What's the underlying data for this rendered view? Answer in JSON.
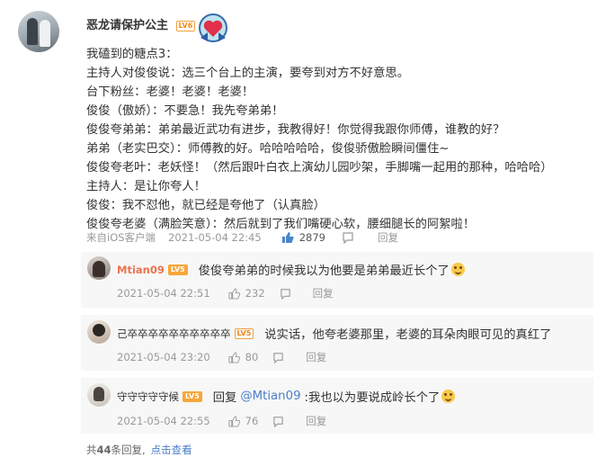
{
  "post": {
    "username": "恶龙请保护公主",
    "level": "LV6",
    "lines": [
      "我磕到的糖点3：",
      "主持人对俊俊说：选三个台上的主演，要夸到对方不好意思。",
      "台下粉丝：老婆！老婆！老婆！",
      "俊俊（傲娇）：不要急！我先夸弟弟！",
      "俊俊夸弟弟：弟弟最近武功有进步，我教得好！你觉得我跟你师傅，谁教的好？",
      "弟弟（老实巴交）：师傅教的好。哈哈哈哈哈，俊俊骄傲脸瞬间僵住~",
      "俊俊夸老叶：老妖怪！（然后跟叶白衣上演幼儿园吵架，手脚嘴一起用的那种，哈哈哈）",
      "主持人：是让你夸人！",
      "俊俊：我不怼他，就已经是夸他了（认真脸）",
      "俊俊夸老婆（满脸笑意）：然后就到了我们嘴硬心软，腰细腿长的阿絮啦！"
    ],
    "source": "来自iOS客户端",
    "time": "2021-05-04 22:45",
    "likes": "2879",
    "reply_label": "回复"
  },
  "replies": [
    {
      "name": "Mtian09",
      "name_color": "#eb7350",
      "level": "LV5",
      "text": "俊俊夸弟弟的时候我以为他要是弟弟最近长个了",
      "time": "2021-05-04 22:51",
      "likes": "232",
      "reply_label": "回复"
    },
    {
      "name": "己卒卒卒卒卒卒卒卒卒卒",
      "name_color": "#333333",
      "level": "LV5",
      "text": "说实话，他夸老婆那里，老婆的耳朵肉眼可见的真红了",
      "time": "2021-05-04 23:20",
      "likes": "80",
      "reply_label": "回复"
    },
    {
      "name": "守守守守守候",
      "name_color": "#333333",
      "level": "LV5",
      "text_prefix": "回复 ",
      "mention": "@Mtian09",
      "text": ":我也以为要说成岭长个了",
      "time": "2021-05-04 22:55",
      "likes": "76",
      "reply_label": "回复"
    }
  ],
  "footer": {
    "total_prefix": "共",
    "total_count": "44",
    "total_suffix": "条回复,",
    "view_link": "点击查看"
  },
  "colors": {
    "accent": "#eb7350",
    "link": "#4a7ec9",
    "reply_bg": "#f7f7f7",
    "meta": "#999999"
  }
}
